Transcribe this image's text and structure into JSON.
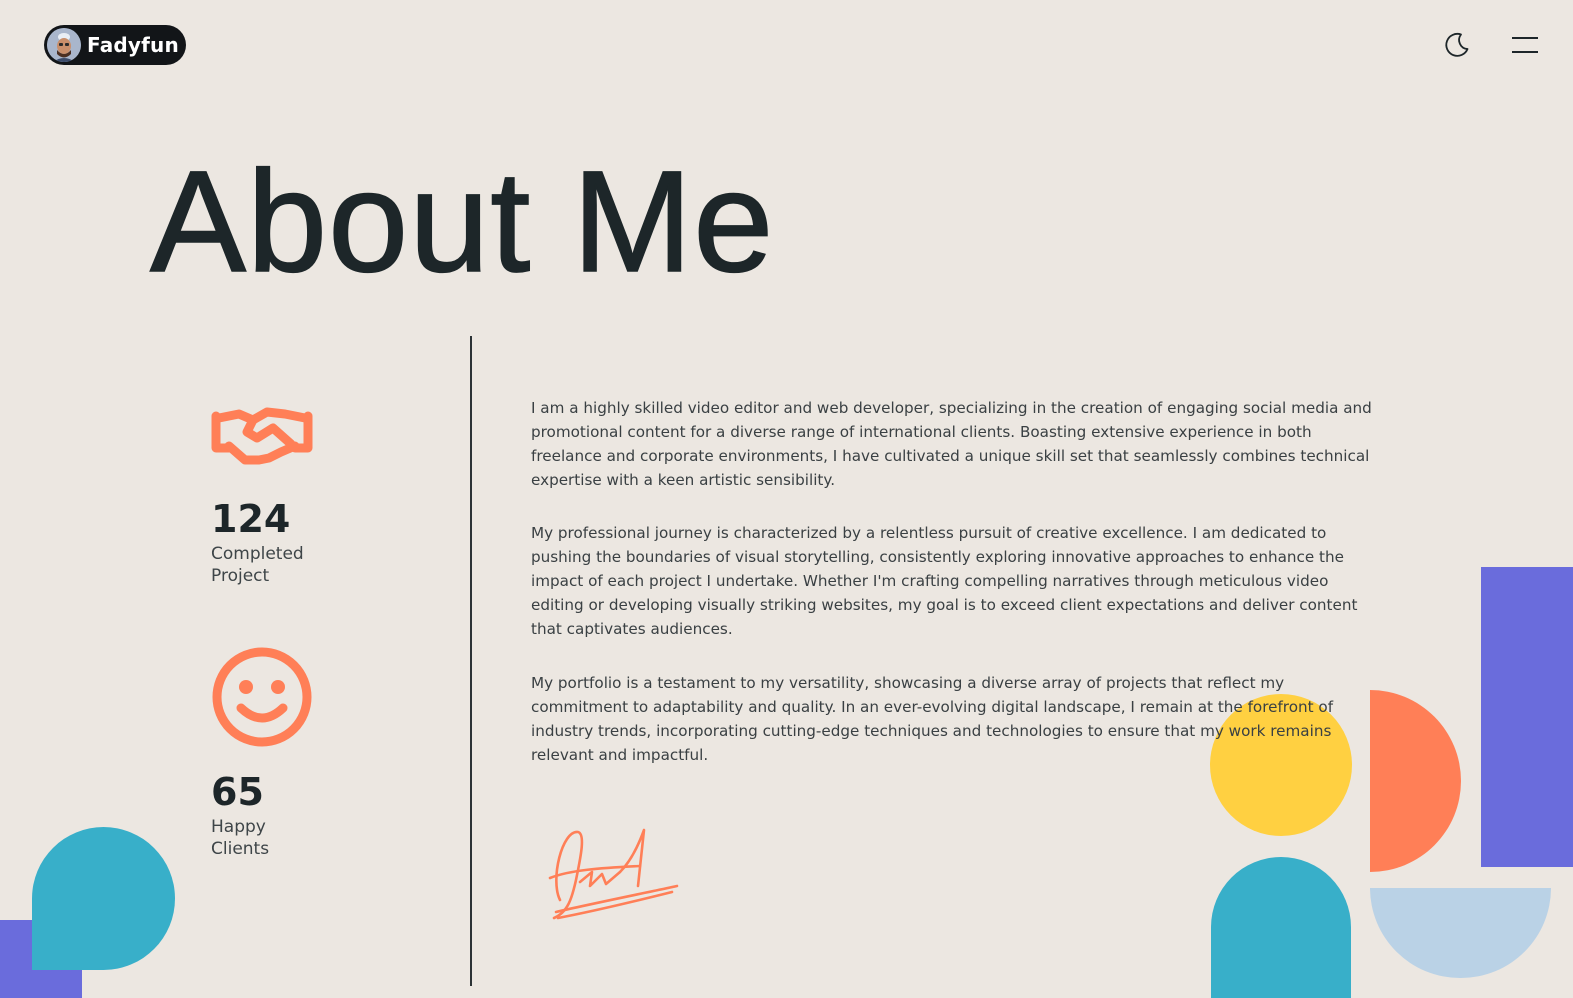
{
  "header": {
    "logo_text": "Fadyfun",
    "avatar_icon": "avatar",
    "theme_toggle_icon": "moon-icon",
    "menu_icon": "hamburger-menu-icon"
  },
  "page": {
    "title": "About Me"
  },
  "stats": [
    {
      "icon": "handshake-icon",
      "value": "124",
      "label_line1": "Completed",
      "label_line2": "Project"
    },
    {
      "icon": "smiley-icon",
      "value": "65",
      "label_line1": "Happy",
      "label_line2": "Clients"
    }
  ],
  "about": {
    "paragraphs": [
      "I am a highly skilled video editor and web developer, specializing in the creation of engaging social media and promotional content for a diverse range of international clients. Boasting extensive experience in both freelance and corporate environments, I have cultivated a unique skill set that seamlessly combines technical expertise with a keen artistic sensibility.",
      "My professional journey is characterized by a relentless pursuit of creative excellence. I am dedicated to pushing the boundaries of visual storytelling, consistently exploring innovative approaches to enhance the impact of each project I undertake. Whether I'm crafting compelling narratives through meticulous video editing or developing visually striking websites, my goal is to exceed client expectations and deliver content that captivates audiences.",
      "My portfolio is a testament to my versatility, showcasing a diverse array of projects that reflect my commitment to adaptability and quality. In an ever-evolving digital landscape, I remain at the forefront of industry trends, incorporating cutting-edge techniques and technologies to ensure that my work remains relevant and impactful."
    ],
    "signature_icon": "signature-icon"
  },
  "colors": {
    "background": "#ece7e1",
    "text_dark": "#1d2629",
    "accent_orange": "#ff7f57",
    "purple": "#6a6cdc",
    "yellow": "#ffd041",
    "teal": "#38afc9",
    "light_blue": "#bad2e6"
  }
}
